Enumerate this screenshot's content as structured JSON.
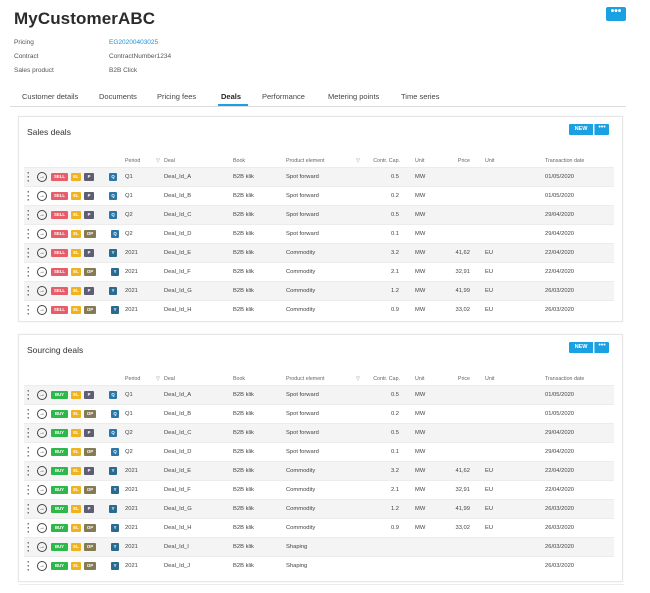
{
  "header": {
    "title": "MyCustomerABC",
    "more_label": "•••"
  },
  "meta": [
    {
      "label": "Pricing",
      "value": "EG20200403025",
      "is_link": true
    },
    {
      "label": "Contract",
      "value": "ContractNumber1234",
      "is_link": false
    },
    {
      "label": "Sales product",
      "value": "B2B Click",
      "is_link": false
    }
  ],
  "tabs": [
    {
      "label": "Customer details",
      "active": false
    },
    {
      "label": "Documents",
      "active": false
    },
    {
      "label": "Pricing fees",
      "active": false
    },
    {
      "label": "Deals",
      "active": true
    },
    {
      "label": "Performance",
      "active": false
    },
    {
      "label": "Metering points",
      "active": false
    },
    {
      "label": "Time series",
      "active": false
    }
  ],
  "columns": {
    "period": "Period",
    "deal": "Deal",
    "book": "Book",
    "product_element": "Product element",
    "contr_cap": "Contr. Cap.",
    "unit": "Unit",
    "price": "Price",
    "unit2": "Unit",
    "transaction_date": "Transaction date"
  },
  "sales_deals": {
    "title": "Sales deals",
    "new_label": "NEW",
    "kebab_label": "•••",
    "rows": [
      {
        "side": "SELL",
        "el": "EL",
        "type": "P",
        "period_badge": "Q",
        "period": "Q1",
        "deal": "Deal_Id_A",
        "book": "B2B klik",
        "product": "Spot forward",
        "cap": "0.5",
        "unit": "MW",
        "price": "",
        "unit2": "",
        "date": "01/05/2020"
      },
      {
        "side": "SELL",
        "el": "EL",
        "type": "P",
        "period_badge": "Q",
        "period": "Q1",
        "deal": "Deal_Id_B",
        "book": "B2B klik",
        "product": "Spot forward",
        "cap": "0.2",
        "unit": "MW",
        "price": "",
        "unit2": "",
        "date": "01/05/2020"
      },
      {
        "side": "SELL",
        "el": "EL",
        "type": "P",
        "period_badge": "Q",
        "period": "Q2",
        "deal": "Deal_Id_C",
        "book": "B2B klik",
        "product": "Spot forward",
        "cap": "0.5",
        "unit": "MW",
        "price": "",
        "unit2": "",
        "date": "29/04/2020"
      },
      {
        "side": "SELL",
        "el": "EL",
        "type": "OP",
        "period_badge": "Q",
        "period": "Q2",
        "deal": "Deal_Id_D",
        "book": "B2B klik",
        "product": "Spot forward",
        "cap": "0.1",
        "unit": "MW",
        "price": "",
        "unit2": "",
        "date": "29/04/2020"
      },
      {
        "side": "SELL",
        "el": "EL",
        "type": "P",
        "period_badge": "Y",
        "period": "2021",
        "deal": "Deal_Id_E",
        "book": "B2B klik",
        "product": "Commodity",
        "cap": "3.2",
        "unit": "MW",
        "price": "41,62",
        "unit2": "EU",
        "date": "22/04/2020"
      },
      {
        "side": "SELL",
        "el": "EL",
        "type": "OP",
        "period_badge": "Y",
        "period": "2021",
        "deal": "Deal_Id_F",
        "book": "B2B klik",
        "product": "Commodity",
        "cap": "2.1",
        "unit": "MW",
        "price": "32,91",
        "unit2": "EU",
        "date": "22/04/2020"
      },
      {
        "side": "SELL",
        "el": "EL",
        "type": "P",
        "period_badge": "Y",
        "period": "2021",
        "deal": "Deal_Id_G",
        "book": "B2B klik",
        "product": "Commodity",
        "cap": "1.2",
        "unit": "MW",
        "price": "41,99",
        "unit2": "EU",
        "date": "26/03/2020"
      },
      {
        "side": "SELL",
        "el": "EL",
        "type": "OP",
        "period_badge": "Y",
        "period": "2021",
        "deal": "Deal_Id_H",
        "book": "B2B klik",
        "product": "Commodity",
        "cap": "0.9",
        "unit": "MW",
        "price": "33,02",
        "unit2": "EU",
        "date": "26/03/2020"
      }
    ]
  },
  "sourcing_deals": {
    "title": "Sourcing deals",
    "new_label": "NEW",
    "kebab_label": "•••",
    "rows": [
      {
        "side": "BUY",
        "el": "EL",
        "type": "P",
        "period_badge": "Q",
        "period": "Q1",
        "deal": "Deal_Id_A",
        "book": "B2B klik",
        "product": "Spot forward",
        "cap": "0.5",
        "unit": "MW",
        "price": "",
        "unit2": "",
        "date": "01/05/2020"
      },
      {
        "side": "BUY",
        "el": "EL",
        "type": "OP",
        "period_badge": "Q",
        "period": "Q1",
        "deal": "Deal_Id_B",
        "book": "B2B klik",
        "product": "Spot forward",
        "cap": "0.2",
        "unit": "MW",
        "price": "",
        "unit2": "",
        "date": "01/05/2020"
      },
      {
        "side": "BUY",
        "el": "EL",
        "type": "P",
        "period_badge": "Q",
        "period": "Q2",
        "deal": "Deal_Id_C",
        "book": "B2B klik",
        "product": "Spot forward",
        "cap": "0.5",
        "unit": "MW",
        "price": "",
        "unit2": "",
        "date": "29/04/2020"
      },
      {
        "side": "BUY",
        "el": "EL",
        "type": "OP",
        "period_badge": "Q",
        "period": "Q2",
        "deal": "Deal_Id_D",
        "book": "B2B klik",
        "product": "Spot forward",
        "cap": "0.1",
        "unit": "MW",
        "price": "",
        "unit2": "",
        "date": "29/04/2020"
      },
      {
        "side": "BUY",
        "el": "EL",
        "type": "P",
        "period_badge": "Y",
        "period": "2021",
        "deal": "Deal_Id_E",
        "book": "B2B klik",
        "product": "Commodity",
        "cap": "3.2",
        "unit": "MW",
        "price": "41,62",
        "unit2": "EU",
        "date": "22/04/2020"
      },
      {
        "side": "BUY",
        "el": "EL",
        "type": "OP",
        "period_badge": "Y",
        "period": "2021",
        "deal": "Deal_Id_F",
        "book": "B2B klik",
        "product": "Commodity",
        "cap": "2.1",
        "unit": "MW",
        "price": "32,91",
        "unit2": "EU",
        "date": "22/04/2020"
      },
      {
        "side": "BUY",
        "el": "EL",
        "type": "P",
        "period_badge": "Y",
        "period": "2021",
        "deal": "Deal_Id_G",
        "book": "B2B klik",
        "product": "Commodity",
        "cap": "1.2",
        "unit": "MW",
        "price": "41,99",
        "unit2": "EU",
        "date": "26/03/2020"
      },
      {
        "side": "BUY",
        "el": "EL",
        "type": "OP",
        "period_badge": "Y",
        "period": "2021",
        "deal": "Deal_Id_H",
        "book": "B2B klik",
        "product": "Commodity",
        "cap": "0.9",
        "unit": "MW",
        "price": "33,02",
        "unit2": "EU",
        "date": "26/03/2020"
      },
      {
        "side": "BUY",
        "el": "EL",
        "type": "OP",
        "period_badge": "Y",
        "period": "2021",
        "deal": "Deal_Id_I",
        "book": "B2B klik",
        "product": "Shaping",
        "cap": "",
        "unit": "",
        "price": "",
        "unit2": "",
        "date": "26/03/2020"
      },
      {
        "side": "BUY",
        "el": "EL",
        "type": "OP",
        "period_badge": "Y",
        "period": "2021",
        "deal": "Deal_Id_J",
        "book": "B2B klik",
        "product": "Shaping",
        "cap": "",
        "unit": "",
        "price": "",
        "unit2": "",
        "date": "26/03/2020"
      }
    ]
  },
  "colors": {
    "accent": "#1aa1e3",
    "sell": "#e85d6a",
    "buy": "#2fb84a",
    "el": "#f0b21d",
    "type_p": "#5d5d73",
    "type_op": "#847b55",
    "period_badge": "#2b78a8"
  }
}
